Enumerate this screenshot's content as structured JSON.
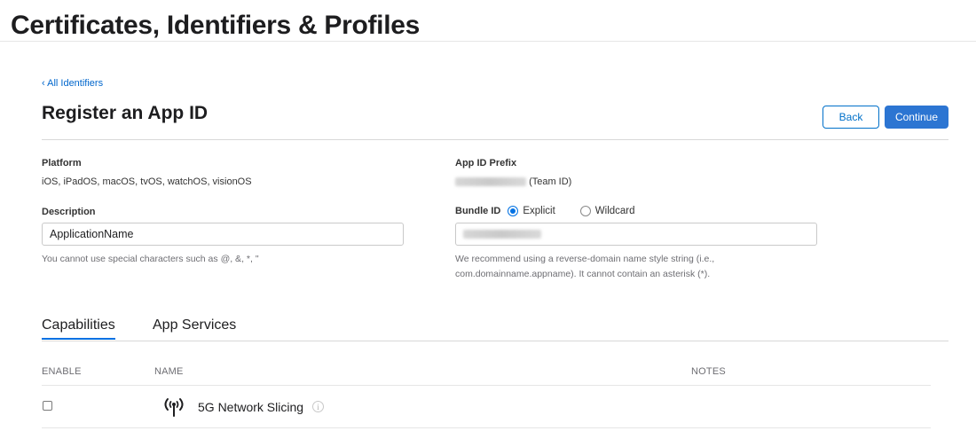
{
  "header": {
    "title": "Certificates, Identifiers & Profiles"
  },
  "nav": {
    "back_link": "‹ All Identifiers"
  },
  "page": {
    "title": "Register an App ID",
    "back_button": "Back",
    "continue_button": "Continue"
  },
  "form": {
    "platform": {
      "label": "Platform",
      "value": "iOS, iPadOS, macOS, tvOS, watchOS, visionOS"
    },
    "app_id_prefix": {
      "label": "App ID Prefix",
      "suffix": "(Team ID)"
    },
    "description": {
      "label": "Description",
      "value": "ApplicationName",
      "hint": "You cannot use special characters such as @, &, *, \""
    },
    "bundle_id": {
      "label": "Bundle ID",
      "options": [
        "Explicit",
        "Wildcard"
      ],
      "selected": "Explicit",
      "hint_line1": "We recommend using a reverse-domain name style string (i.e.,",
      "hint_line2": "com.domainname.appname). It cannot contain an asterisk (*)."
    }
  },
  "tabs": [
    {
      "label": "Capabilities",
      "active": true
    },
    {
      "label": "App Services",
      "active": false
    }
  ],
  "table": {
    "columns": [
      "ENABLE",
      "NAME",
      "NOTES"
    ],
    "rows": [
      {
        "name": "5G Network Slicing",
        "icon": "antenna-icon",
        "enabled": false,
        "info_glyph": "i"
      }
    ]
  },
  "colors": {
    "accent": "#0071e3",
    "button": "#2c75d2"
  }
}
